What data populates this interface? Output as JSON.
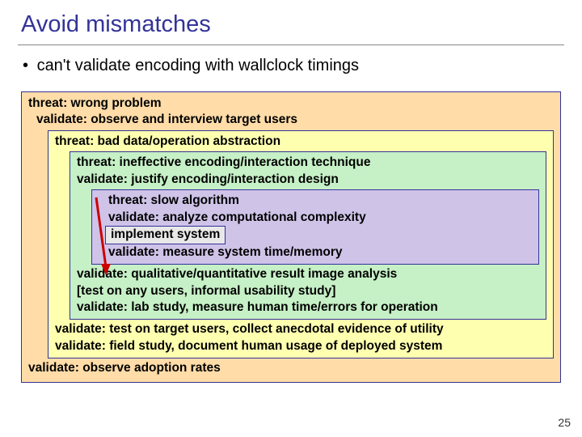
{
  "title": "Avoid mismatches",
  "bullet": "can't validate encoding with wallclock timings",
  "outer": {
    "l1": "threat: wrong problem",
    "l2": "validate: observe and interview target users",
    "l_last": "validate: observe adoption rates"
  },
  "yellow": {
    "l1": "threat: bad data/operation abstraction",
    "l_a": "validate: test on target users, collect anecdotal evidence of utility",
    "l_b": "validate: field study, document human usage of deployed system"
  },
  "green": {
    "l1": "threat: ineffective encoding/interaction technique",
    "l2": "validate: justify encoding/interaction design",
    "l_a": "validate: qualitative/quantitative result image analysis",
    "l_b": "[test on any users, informal usability study]",
    "l_c": "validate: lab study, measure human time/errors for operation"
  },
  "purple": {
    "l1": "threat: slow algorithm",
    "l2": "validate: analyze computational complexity",
    "impl": "implement system",
    "l_last": "validate: measure system time/memory"
  },
  "pagenum": "25"
}
